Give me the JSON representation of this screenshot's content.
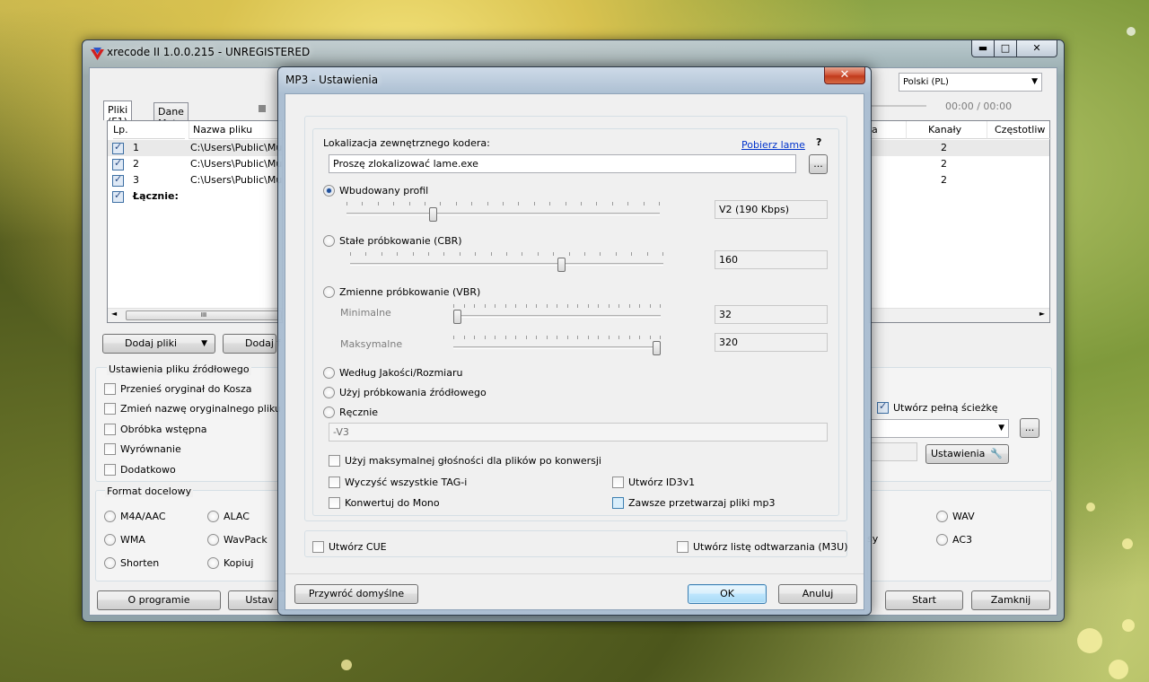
{
  "main_window": {
    "title": "xrecode II 1.0.0.215 - UNREGISTERED",
    "caption_buttons": {
      "minimize": "▬",
      "maximize": "□",
      "close": "✕"
    },
    "language_select": "Polski (PL)",
    "time_display": "00:00 / 00:00",
    "tabs": [
      "Pliki (F1)",
      "Dane Meta (F2)"
    ],
    "list_headers": [
      "Lp.",
      "Nazwa pliku źródło"
    ],
    "right_headers": [
      "a",
      "Kanały",
      "Częstotliw"
    ],
    "rows": [
      {
        "num": "1",
        "path": "C:\\Users\\Public\\Mu",
        "channels": "2"
      },
      {
        "num": "2",
        "path": "C:\\Users\\Public\\Mu",
        "channels": "2"
      },
      {
        "num": "3",
        "path": "C:\\Users\\Public\\Mu",
        "channels": "2"
      }
    ],
    "total_label": "Łącznie:",
    "hscroll_grip": "III",
    "add_files_button": "Dodaj pliki",
    "add_folder_button": "Dodaj f",
    "source_settings_title": "Ustawienia pliku źródłowego",
    "source_options": [
      "Przenieś oryginał do Kosza",
      "Zmień nazwę oryginalnego pliku p",
      "Obróbka wstępna",
      "Wyrównanie",
      "Dodatkowo"
    ],
    "full_path_checkbox": "Utwórz pełną ścieżkę",
    "settings_button": "Ustawienia",
    "browse_button": "...",
    "format_title": "Format docelowy",
    "formats_left": [
      "M4A/AAC",
      "WMA",
      "Shorten"
    ],
    "formats_mid": [
      "ALAC",
      "WavPack",
      "Kopiuj"
    ],
    "formats_right": [
      "WAV",
      "AC3"
    ],
    "format_partial": "sy",
    "about_button": "O programie",
    "settings_bottom_button": "Ustav",
    "start_button": "Start",
    "close_button": "Zamknij"
  },
  "dialog": {
    "title": "MP3 - Ustawienia",
    "close_glyph": "✕",
    "encoder_location_label": "Lokalizacja zewnętrznego kodera:",
    "download_lame_link": "Pobierz lame",
    "help_glyph": "?",
    "encoder_path_value": "Proszę zlokalizować lame.exe",
    "browse_button": "...",
    "builtin_profile_label": "Wbudowany profil",
    "builtin_profile_value": "V2 (190 Kbps)",
    "builtin_profile_level": 0.27,
    "cbr_label": "Stałe próbkowanie (CBR)",
    "cbr_value": "160",
    "cbr_level": 0.68,
    "vbr_label": "Zmienne próbkowanie (VBR)",
    "vbr_min_label": "Minimalne",
    "vbr_min_value": "32",
    "vbr_min_level": 0.0,
    "vbr_max_label": "Maksymalne",
    "vbr_max_value": "320",
    "vbr_max_level": 1.0,
    "quality_size_label": "Według Jakości/Rozmiaru",
    "source_sampling_label": "Użyj próbkowania źródłowego",
    "manual_label": "Ręcznie",
    "manual_value": "-V3",
    "max_volume_label": "Użyj maksymalnej głośności dla plików po konwersji",
    "clear_tags_label": "Wyczyść wszystkie TAG-i",
    "create_id3v1_label": "Utwórz ID3v1",
    "to_mono_label": "Konwertuj do Mono",
    "always_process_label": "Zawsze przetwarzaj pliki mp3",
    "create_cue_label": "Utwórz CUE",
    "create_playlist_label": "Utwórz listę odtwarzania (M3U)",
    "restore_defaults_button": "Przywróć domyślne",
    "ok_button": "OK",
    "cancel_button": "Anuluj"
  }
}
